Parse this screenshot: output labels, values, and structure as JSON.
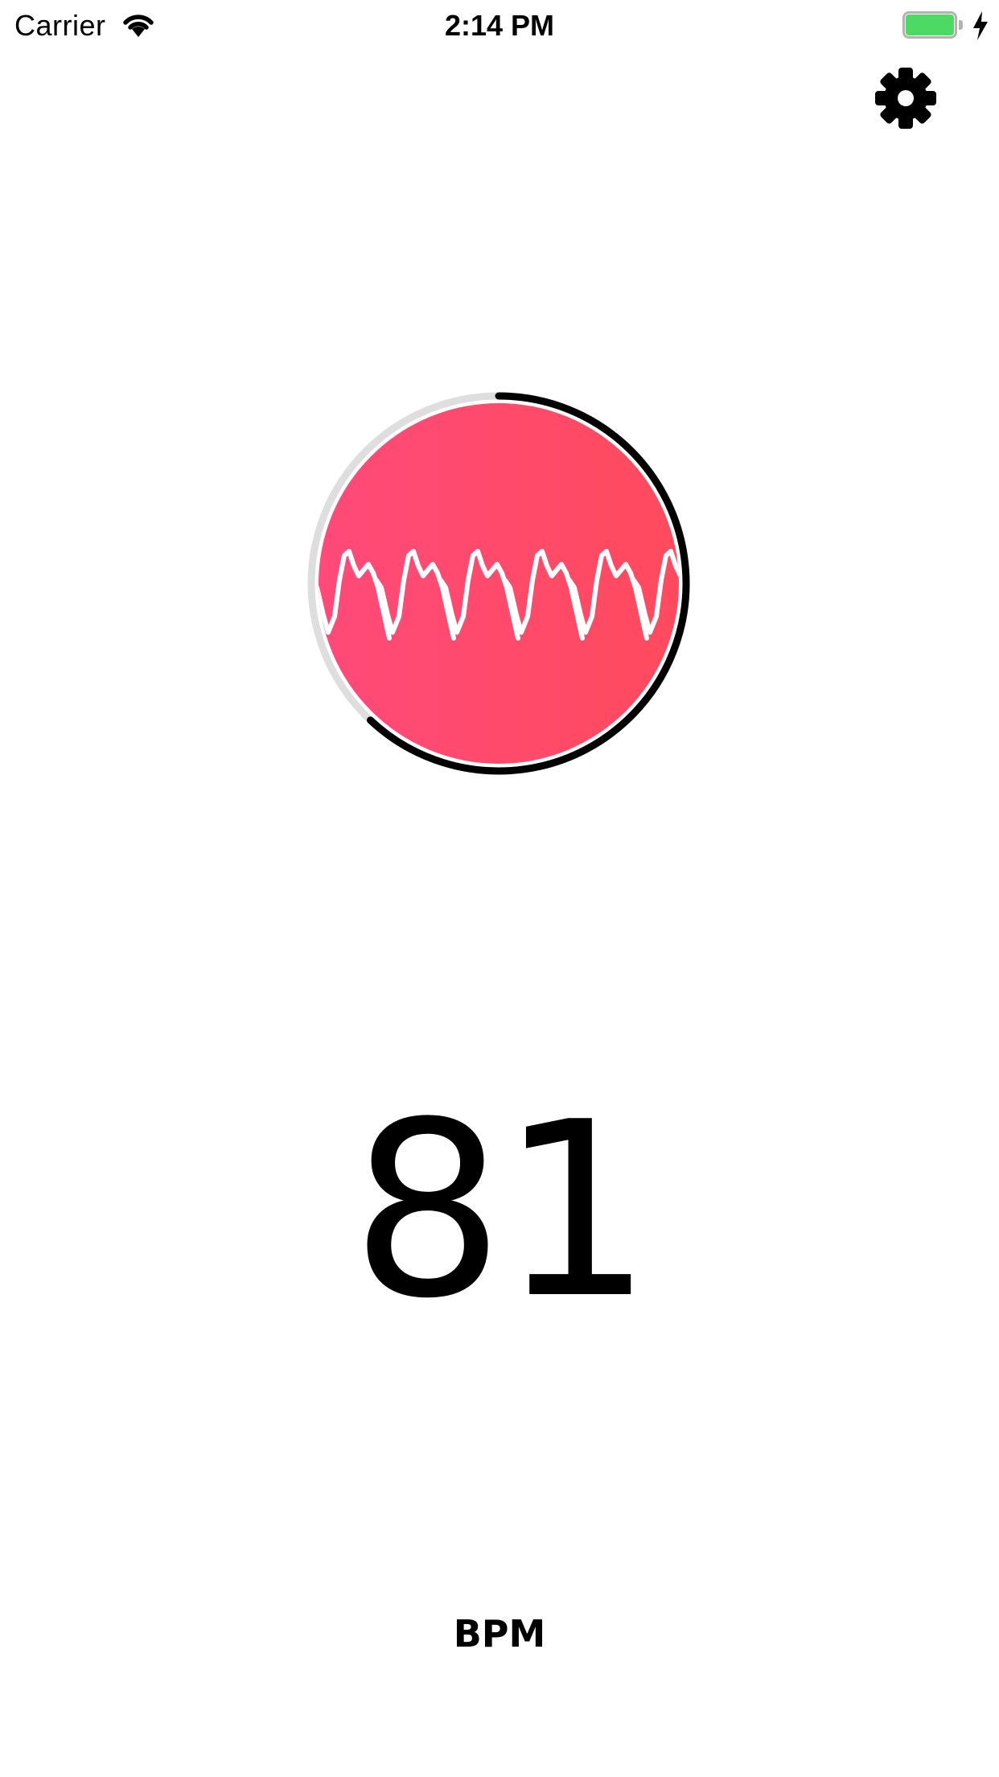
{
  "status_bar": {
    "carrier": "Carrier",
    "time": "2:14 PM",
    "wifi_icon": "wifi-icon",
    "battery_icon": "battery-icon",
    "charging_icon": "charging-bolt-icon",
    "battery_color": "#4cd964"
  },
  "toolbar": {
    "settings_icon": "gear-icon"
  },
  "meter": {
    "progress": 0.62,
    "fill_gradient": [
      "#ff4a7a",
      "#ff4a5e"
    ],
    "track_color": "#dedede",
    "progress_color": "#000000",
    "waveform_color": "#ffffff"
  },
  "reading": {
    "value": "81",
    "unit": "BPM"
  }
}
